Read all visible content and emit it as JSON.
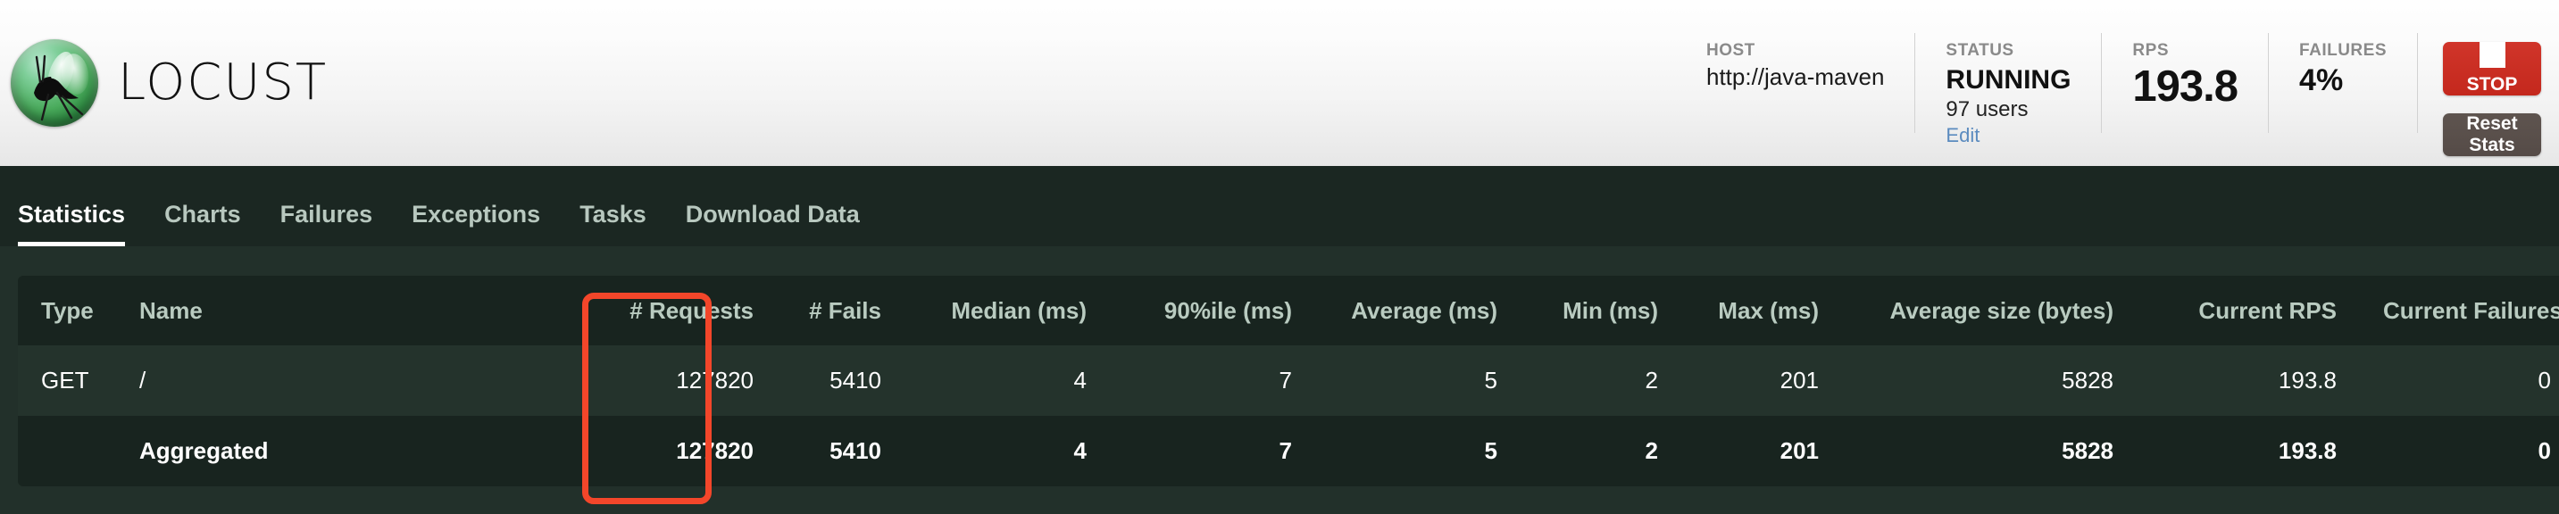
{
  "brand": {
    "name": "LOCUST",
    "logo_icon": "locust-logo-icon"
  },
  "header": {
    "stats": [
      {
        "label": "HOST",
        "value": "http://java-maven"
      },
      {
        "label": "STATUS",
        "value": "RUNNING",
        "users": "97 users",
        "edit_label": "Edit"
      },
      {
        "label": "RPS",
        "value": "193.8"
      },
      {
        "label": "FAILURES",
        "value": "4%"
      }
    ],
    "buttons": {
      "stop_label": "STOP",
      "stop_icon": "stop-square-icon",
      "stop_color": "#c4281d",
      "reset_label_line1": "Reset",
      "reset_label_line2": "Stats",
      "reset_color": "#554b47"
    }
  },
  "nav": {
    "items": [
      {
        "label": "Statistics",
        "active": true
      },
      {
        "label": "Charts",
        "active": false
      },
      {
        "label": "Failures",
        "active": false
      },
      {
        "label": "Exceptions",
        "active": false
      },
      {
        "label": "Tasks",
        "active": false
      },
      {
        "label": "Download Data",
        "active": false
      }
    ]
  },
  "table": {
    "columns": [
      "Type",
      "Name",
      "# Requests",
      "# Fails",
      "Median (ms)",
      "90%ile (ms)",
      "Average (ms)",
      "Min (ms)",
      "Max (ms)",
      "Average size (bytes)",
      "Current RPS",
      "Current Failures/s"
    ],
    "rows": [
      {
        "type": "GET",
        "name": "/",
        "requests": "127820",
        "fails": "5410",
        "median": "4",
        "p90": "7",
        "average": "5",
        "min": "2",
        "max": "201",
        "avg_size": "5828",
        "current_rps": "193.8",
        "current_failures": "0"
      },
      {
        "type": "",
        "name": "Aggregated",
        "requests": "127820",
        "fails": "5410",
        "median": "4",
        "p90": "7",
        "average": "5",
        "min": "2",
        "max": "201",
        "avg_size": "5828",
        "current_rps": "193.8",
        "current_failures": "0"
      }
    ]
  },
  "annotation": {
    "highlight_target": "# Fails",
    "highlight_color": "#f3462a"
  }
}
